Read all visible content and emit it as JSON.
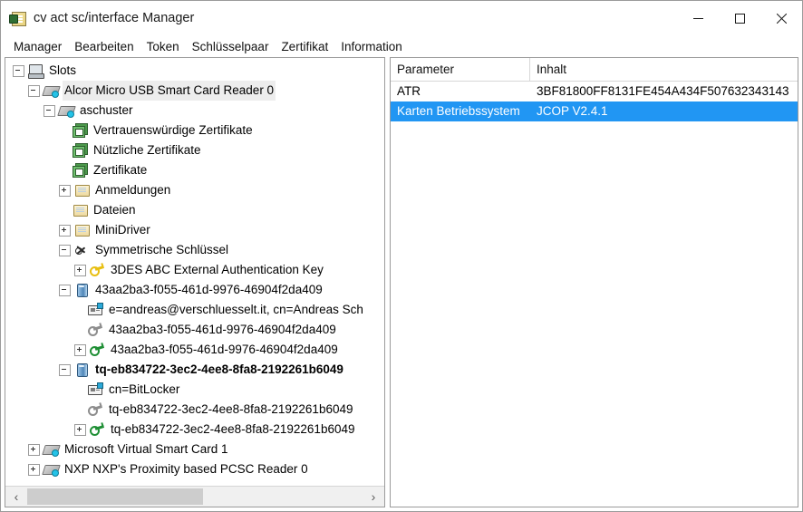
{
  "window": {
    "title": "cv act sc/interface Manager",
    "app_icon": "smartcard-icon",
    "minimize_label": "Minimieren",
    "maximize_label": "Maximieren",
    "close_label": "Schließen"
  },
  "menubar": {
    "items": [
      {
        "label": "Manager"
      },
      {
        "label": "Bearbeiten"
      },
      {
        "label": "Token"
      },
      {
        "label": "Schlüsselpaar"
      },
      {
        "label": "Zertifikat"
      },
      {
        "label": "Information"
      }
    ]
  },
  "tree": {
    "nodes": [
      {
        "label": "Slots",
        "indent": 0,
        "toggle": "minus",
        "icon": "computer-icon",
        "state": "normal"
      },
      {
        "label": "Alcor Micro USB Smart Card Reader 0",
        "indent": 1,
        "toggle": "minus",
        "icon": "card-reader-icon",
        "state": "soft-selected"
      },
      {
        "label": "aschuster",
        "indent": 2,
        "toggle": "minus",
        "icon": "card-reader-icon",
        "state": "normal"
      },
      {
        "label": "Vertrauenswürdige Zertifikate",
        "indent": 3,
        "toggle": "none",
        "icon": "certificate-store-icon",
        "state": "normal"
      },
      {
        "label": "Nützliche Zertifikate",
        "indent": 3,
        "toggle": "none",
        "icon": "certificate-store-icon",
        "state": "normal"
      },
      {
        "label": "Zertifikate",
        "indent": 3,
        "toggle": "none",
        "icon": "certificate-store-icon",
        "state": "normal"
      },
      {
        "label": "Anmeldungen",
        "indent": 3,
        "toggle": "plus",
        "icon": "folder-icon",
        "state": "normal"
      },
      {
        "label": "Dateien",
        "indent": 3,
        "toggle": "none",
        "icon": "folder-icon",
        "state": "normal"
      },
      {
        "label": "MiniDriver",
        "indent": 3,
        "toggle": "plus",
        "icon": "folder-icon",
        "state": "normal"
      },
      {
        "label": "Symmetrische Schlüssel",
        "indent": 3,
        "toggle": "minus",
        "icon": "symmetric-keys-icon",
        "state": "normal"
      },
      {
        "label": "3DES ABC External Authentication Key",
        "indent": 4,
        "toggle": "plus",
        "icon": "key-yellow-icon",
        "state": "normal"
      },
      {
        "label": "43aa2ba3-f055-461d-9976-46904f2da409",
        "indent": 3,
        "toggle": "minus",
        "icon": "container-icon",
        "state": "normal"
      },
      {
        "label": "e=andreas@verschluesselt.it, cn=Andreas Sch",
        "indent": 4,
        "toggle": "none",
        "icon": "certificate-icon",
        "state": "normal"
      },
      {
        "label": "43aa2ba3-f055-461d-9976-46904f2da409",
        "indent": 4,
        "toggle": "none",
        "icon": "key-gray-icon",
        "state": "normal"
      },
      {
        "label": "43aa2ba3-f055-461d-9976-46904f2da409",
        "indent": 4,
        "toggle": "plus",
        "icon": "key-green-icon",
        "state": "normal"
      },
      {
        "label": "tq-eb834722-3ec2-4ee8-8fa8-2192261b6049",
        "indent": 3,
        "toggle": "minus",
        "icon": "container-icon",
        "state": "bold"
      },
      {
        "label": "cn=BitLocker",
        "indent": 4,
        "toggle": "none",
        "icon": "certificate-icon",
        "state": "normal"
      },
      {
        "label": "tq-eb834722-3ec2-4ee8-8fa8-2192261b6049",
        "indent": 4,
        "toggle": "none",
        "icon": "key-gray-icon",
        "state": "normal"
      },
      {
        "label": "tq-eb834722-3ec2-4ee8-8fa8-2192261b6049",
        "indent": 4,
        "toggle": "plus",
        "icon": "key-green-icon",
        "state": "normal"
      },
      {
        "label": "Microsoft Virtual Smart Card 1",
        "indent": 1,
        "toggle": "plus",
        "icon": "card-reader-icon",
        "state": "normal"
      },
      {
        "label": "NXP NXP's Proximity based PCSC Reader 0",
        "indent": 1,
        "toggle": "plus",
        "icon": "card-reader-icon",
        "state": "normal"
      }
    ],
    "scrollbar": {
      "left_arrow": "‹",
      "right_arrow": "›"
    }
  },
  "table": {
    "columns": [
      "Parameter",
      "Inhalt"
    ],
    "rows": [
      {
        "parameter": "ATR",
        "inhalt": "3BF81800FF8131FE454A434F507632343143",
        "selected": false
      },
      {
        "parameter": "Karten Betriebssystem",
        "inhalt": "JCOP V2.4.1",
        "selected": true
      }
    ]
  },
  "colors": {
    "selection": "#2196f3",
    "soft_selection": "#ededed",
    "border": "#9b9b9b"
  }
}
